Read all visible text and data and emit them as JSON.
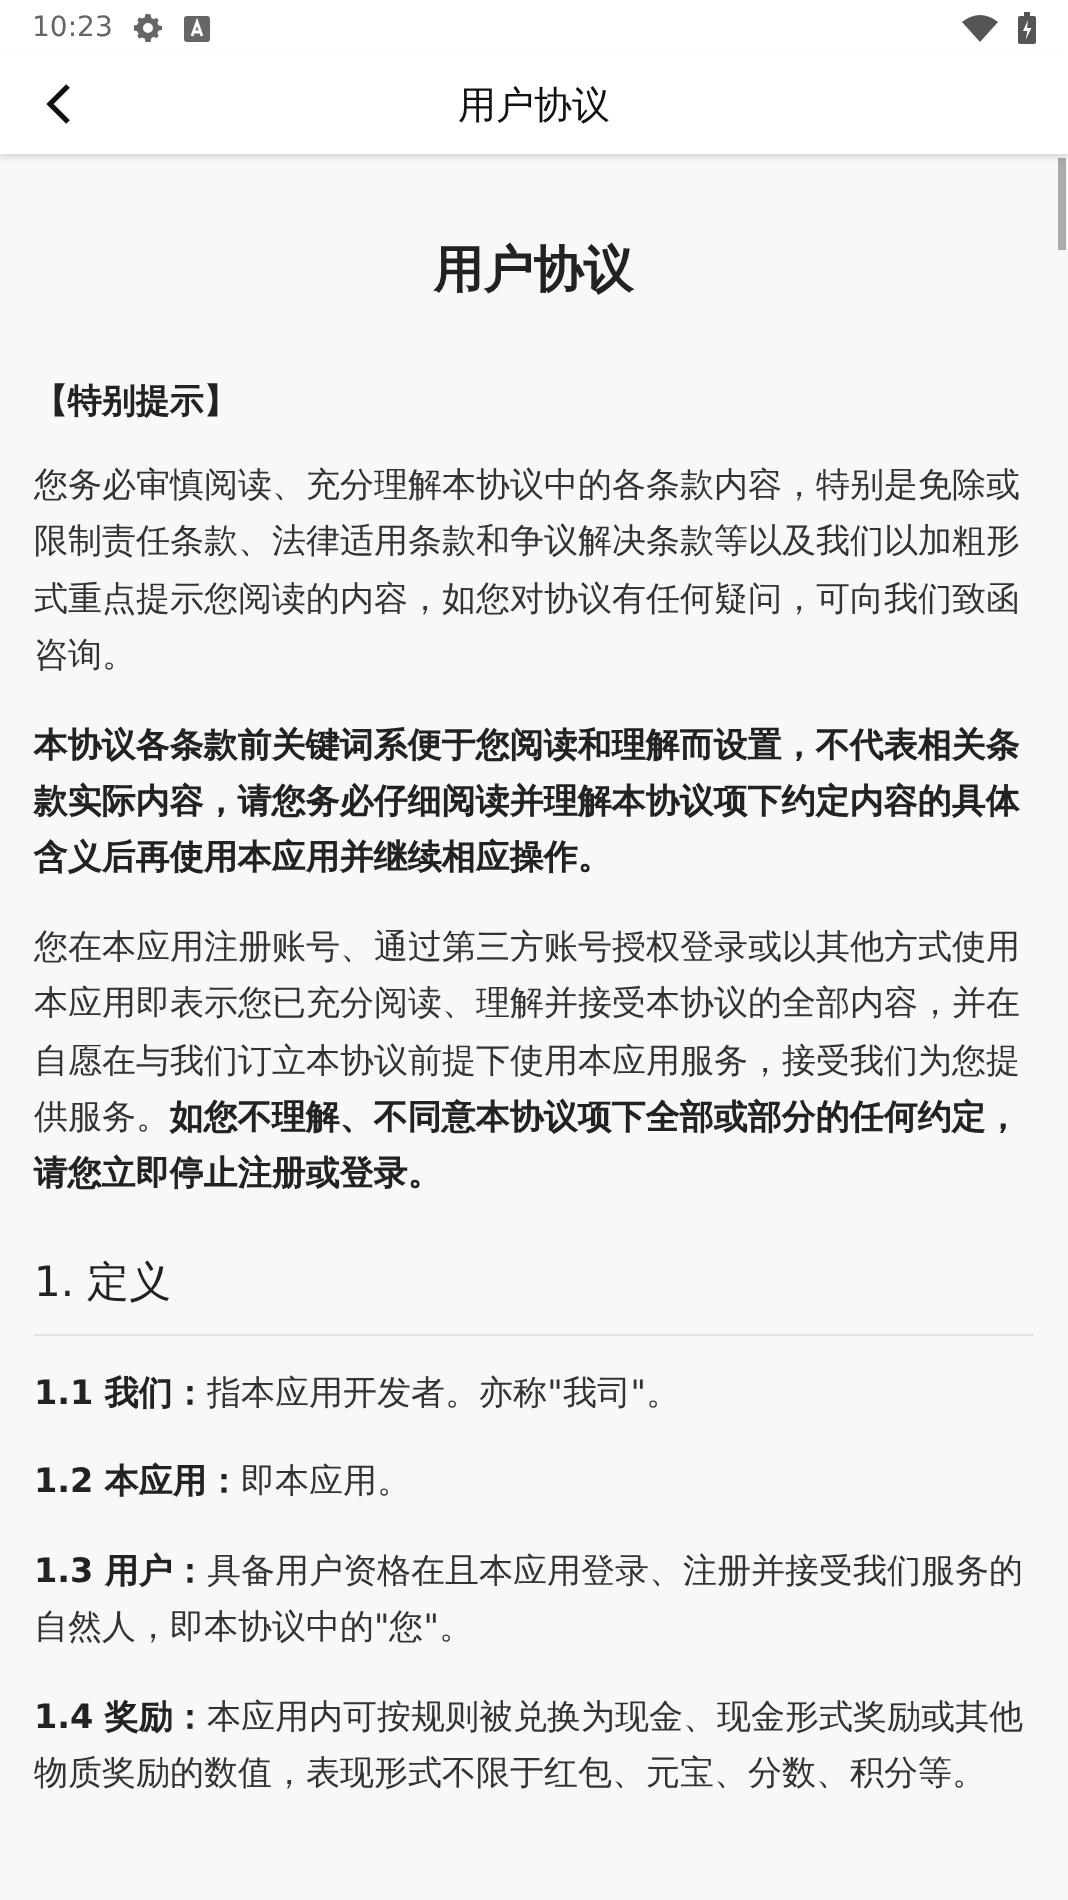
{
  "status_bar": {
    "time": "10:23"
  },
  "toolbar": {
    "title": "用户协议"
  },
  "document": {
    "title": "用户协议",
    "blocks": [
      {
        "kind": "label",
        "text": "【特别提示】"
      },
      {
        "kind": "paragraph",
        "text": "您务必审慎阅读、充分理解本协议中的各条款内容，特别是免除或限制责任条款、法律适用条款和争议解决条款等以及我们以加粗形式重点提示您阅读的内容，如您对协议有任何疑问，可向我们致函咨询。"
      },
      {
        "kind": "bold",
        "text": "本协议各条款前关键词系便于您阅读和理解而设置，不代表相关条款实际内容，请您务必仔细阅读并理解本协议项下约定内容的具体含义后再使用本应用并继续相应操作。"
      },
      {
        "kind": "paragraph",
        "text": "您在本应用注册账号、通过第三方账号授权登录或以其他方式使用本应用即表示您已充分阅读、理解并接受本协议的全部内容，并在自愿在与我们订立本协议前提下使用本应用服务，接受我们为您提供服务。**如您不理解、不同意本协议项下全部或部分的任何约定，请您立即停止注册或登录。**"
      },
      {
        "kind": "heading",
        "text": "1. 定义"
      },
      {
        "kind": "paragraph",
        "text": "**1.1 我们：**指本应用开发者。亦称\"我司\"。"
      },
      {
        "kind": "paragraph",
        "text": "**1.2 本应用：**即本应用。"
      },
      {
        "kind": "paragraph",
        "text": "**1.3 用户：**具备用户资格在且本应用登录、注册并接受我们服务的自然人，即本协议中的\"您\"。"
      },
      {
        "kind": "paragraph",
        "text": "**1.4 奖励：**本应用内可按规则被兑换为现金、现金形式奖励或其他物质奖励的数值，表现形式不限于红包、元宝、分数、积分等。"
      }
    ]
  }
}
